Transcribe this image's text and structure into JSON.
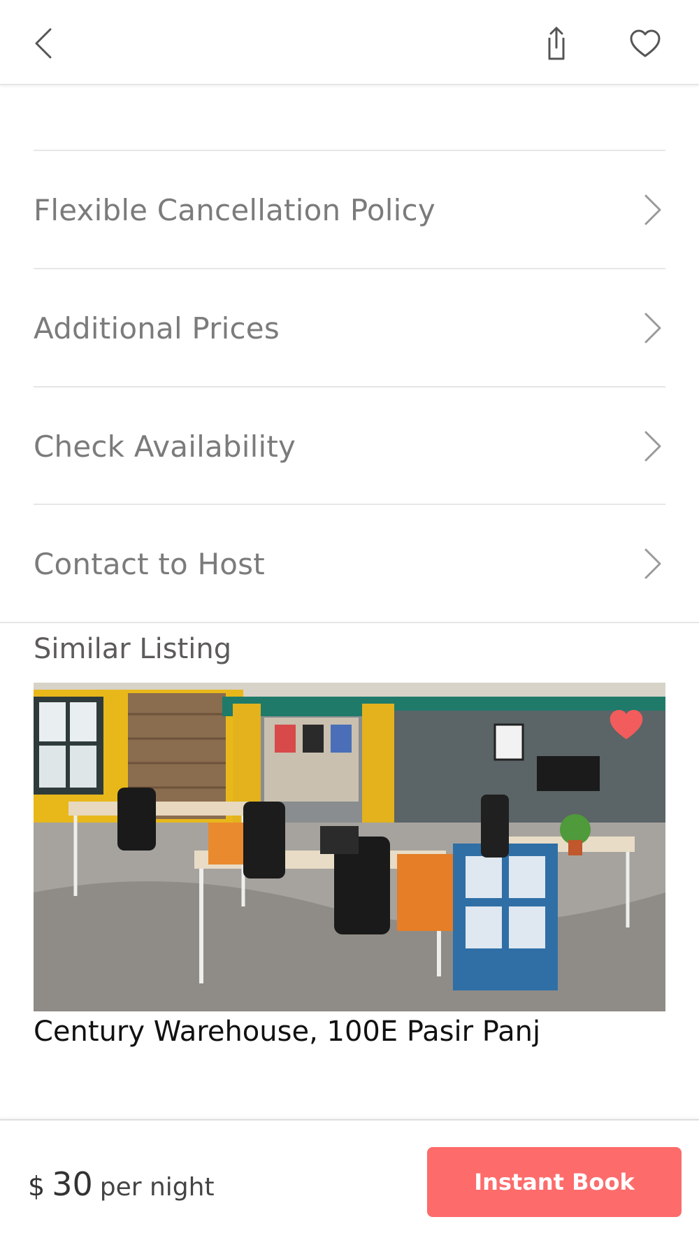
{
  "header": {
    "back_icon": "chevron-left-icon",
    "share_icon": "share-icon",
    "favorite_icon": "heart-outline-icon"
  },
  "menu": {
    "items": [
      {
        "label": "Flexible Cancellation Policy"
      },
      {
        "label": "Additional Prices"
      },
      {
        "label": "Check Availability"
      },
      {
        "label": "Contact to Host"
      }
    ]
  },
  "similar": {
    "section_title": "Similar Listing",
    "listing": {
      "title": "Century Warehouse, 100E Pasir Panj",
      "favorite_icon": "heart-filled-icon",
      "favorite_color": "#f25c5c"
    }
  },
  "footer": {
    "currency": "$",
    "price": "30",
    "per_label": "per night",
    "book_label": "Instant Book",
    "accent_color": "#fd6b6b"
  }
}
